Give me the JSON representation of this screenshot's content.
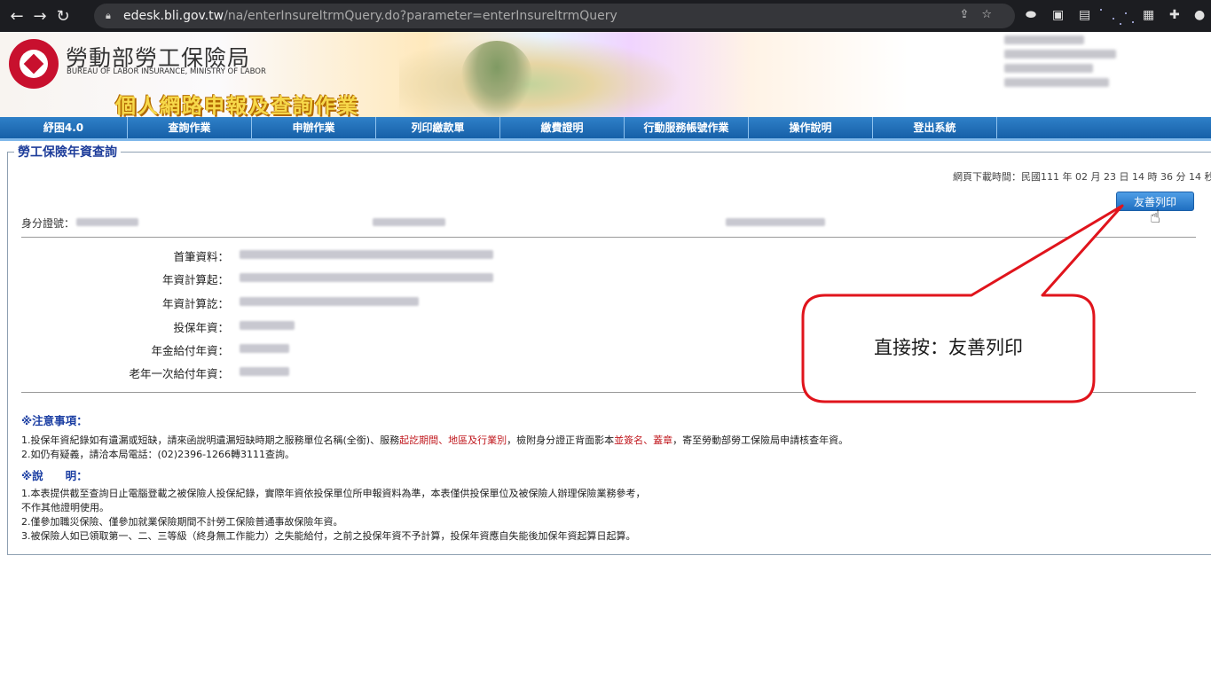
{
  "browser": {
    "url_host": "edesk.bli.gov.tw",
    "url_path": "/na/enterInsureItrmQuery.do?parameter=enterInsureItrmQuery"
  },
  "banner": {
    "org_name_zh": "勞動部勞工保險局",
    "org_name_en": "BUREAU OF LABOR INSURANCE, MINISTRY OF LABOR",
    "slogan": "個人網路申報及查詢作業"
  },
  "nav": {
    "items": [
      "紓困4.0",
      "查詢作業",
      "申辦作業",
      "列印繳款單",
      "繳費證明",
      "行動服務帳號作業",
      "操作說明",
      "登出系統"
    ]
  },
  "page": {
    "section_title": "勞工保險年資查詢",
    "download_time": "網頁下載時間：民國111 年 02 月 23 日 14 時 36 分 14 秒",
    "print_button": "友善列印",
    "id_label": "身分證號：",
    "rows": [
      {
        "label": "首筆資料："
      },
      {
        "label": "年資計算起："
      },
      {
        "label": "年資計算訖："
      },
      {
        "label": "投保年資："
      },
      {
        "label": "年金給付年資："
      },
      {
        "label": "老年一次給付年資："
      }
    ]
  },
  "notes": {
    "title": "※注意事項：",
    "line1_a": "1.投保年資紀錄如有遺漏或短缺，請來函說明遺漏短缺時期之服務單位名稱(全銜)、服務",
    "line1_b": "起訖期間、地區及行業別",
    "line1_c": "，檢附身分證正背面影本",
    "line1_d": "並簽名、蓋章",
    "line1_e": "，寄至勞動部勞工保險局申請核查年資。",
    "line2": "2.如仍有疑義，請洽本局電話：(02)2396-1266轉3111查詢。"
  },
  "explain": {
    "title": "※說　　明：",
    "line1": "1.本表提供截至查詢日止電腦登載之被保險人投保紀錄，實際年資依投保單位所申報資料為準，本表僅供投保單位及被保險人辦理保險業務參考，",
    "line1b": "不作其他證明使用。",
    "line2": "2.僅參加職災保險、僅參加就業保險期間不計勞工保險普通事故保險年資。",
    "line3": "3.被保險人如已領取第一、二、三等級（終身無工作能力）之失能給付，之前之投保年資不予計算，投保年資應自失能後加保年資起算日起算。"
  },
  "callout": {
    "text": "直接按：友善列印",
    "color": "#e0141c"
  },
  "colors": {
    "nav_blue": "#1660a8",
    "title_blue": "#1e3d9a",
    "logo_red": "#c8102e"
  }
}
